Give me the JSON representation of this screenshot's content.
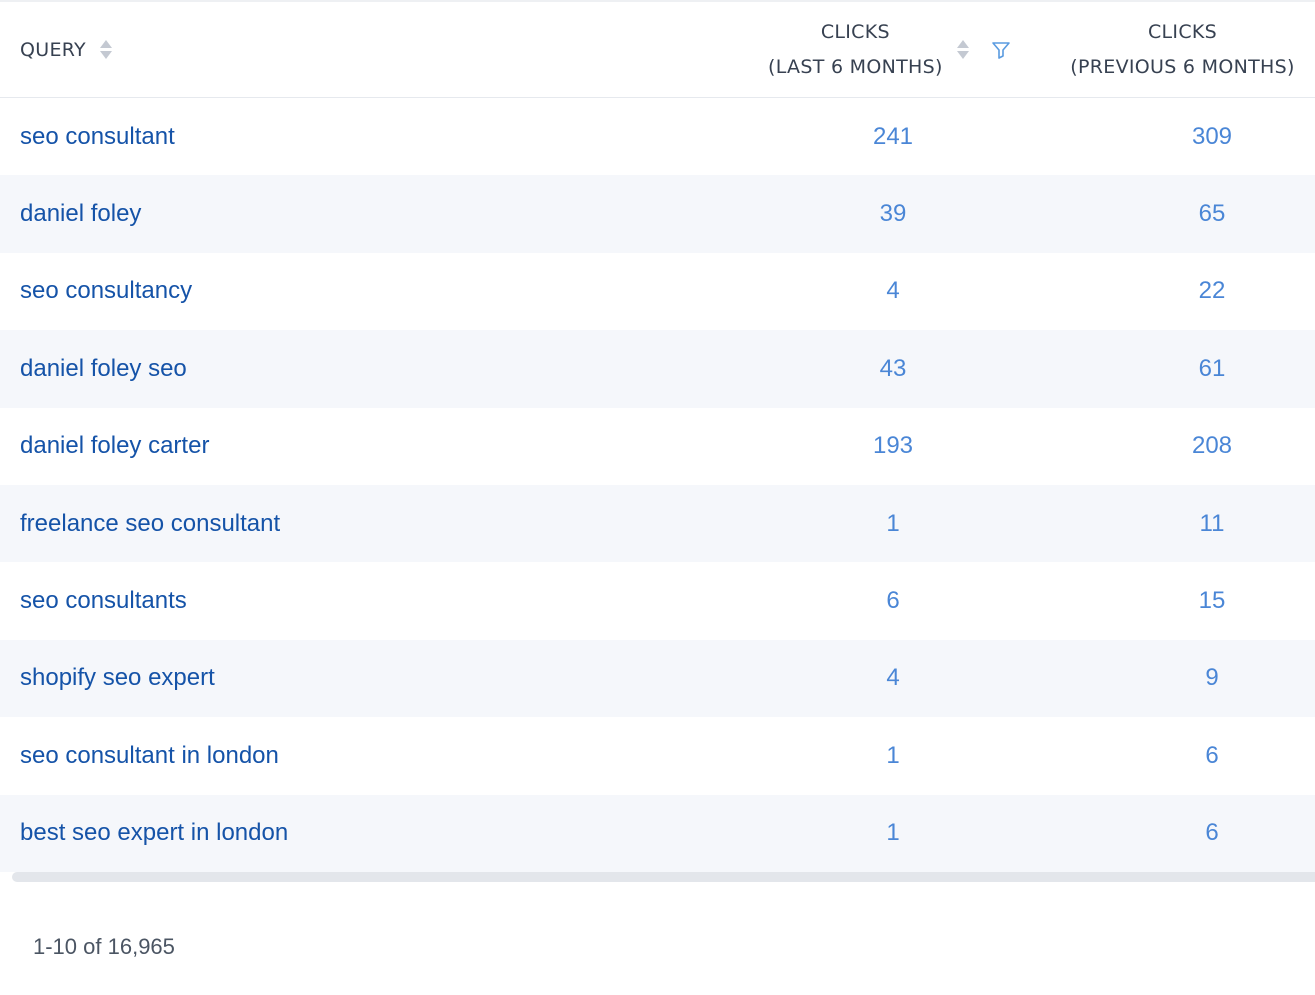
{
  "table": {
    "headers": {
      "query": "QUERY",
      "clicks_last_line1": "CLICKS",
      "clicks_last_line2": "(LAST 6 MONTHS)",
      "clicks_prev_line1": "CLICKS",
      "clicks_prev_line2": "(PREVIOUS 6 MONTHS)"
    },
    "rows": [
      {
        "query": "seo consultant",
        "clicks_last": "241",
        "clicks_prev": "309"
      },
      {
        "query": "daniel foley",
        "clicks_last": "39",
        "clicks_prev": "65"
      },
      {
        "query": "seo consultancy",
        "clicks_last": "4",
        "clicks_prev": "22"
      },
      {
        "query": "daniel foley seo",
        "clicks_last": "43",
        "clicks_prev": "61"
      },
      {
        "query": "daniel foley carter",
        "clicks_last": "193",
        "clicks_prev": "208"
      },
      {
        "query": "freelance seo consultant",
        "clicks_last": "1",
        "clicks_prev": "11"
      },
      {
        "query": "seo consultants",
        "clicks_last": "6",
        "clicks_prev": "15"
      },
      {
        "query": "shopify seo expert",
        "clicks_last": "4",
        "clicks_prev": "9"
      },
      {
        "query": "seo consultant in london",
        "clicks_last": "1",
        "clicks_prev": "6"
      },
      {
        "query": "best seo expert in london",
        "clicks_last": "1",
        "clicks_prev": "6"
      }
    ]
  },
  "pagination": {
    "text": "1-10 of 16,965"
  },
  "icons": {
    "sort": "sort-icon",
    "filter": "filter-icon"
  },
  "colors": {
    "link": "#1553a8",
    "number": "#4a86d6",
    "row_alt": "#f5f7fb",
    "filter_icon": "#5a9be0"
  }
}
